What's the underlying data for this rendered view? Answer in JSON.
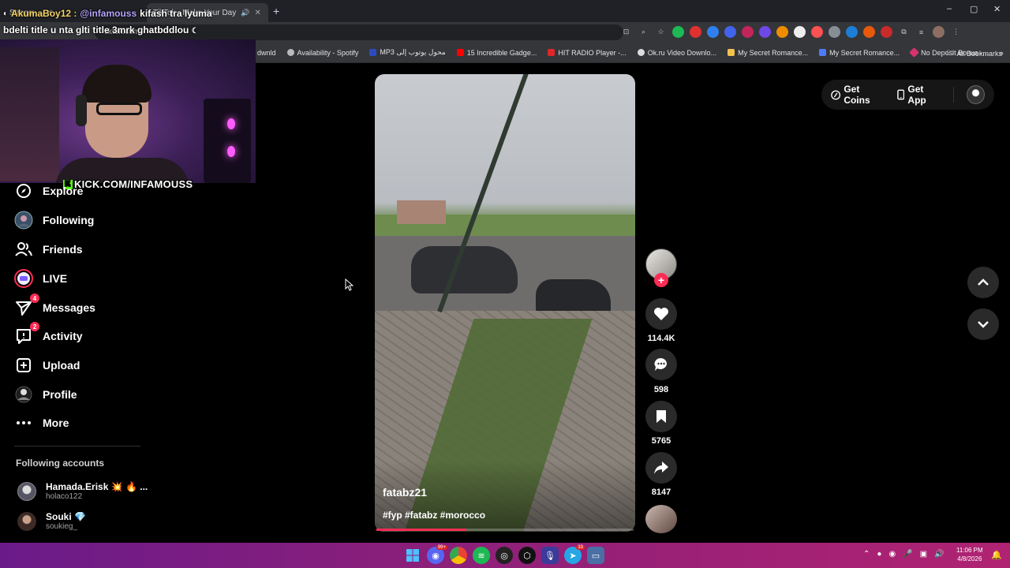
{
  "browser": {
    "tabs": [
      {
        "label": "Stream..."
      },
      {
        "label": "TikTok - Make Your Day"
      }
    ],
    "url": "tiktok.com",
    "new_tab": "+",
    "window": {
      "minimize": "–",
      "maximize": "▢",
      "close": "✕"
    },
    "bookmarks": [
      {
        "label": "dwnld",
        "color": "#888888"
      },
      {
        "label": "Availability - Spotify",
        "color": "#bbbbbb"
      },
      {
        "label": "MP3 محول يوتوب إلى",
        "color": "#2b4cbf"
      },
      {
        "label": "15 Incredible Gadge...",
        "color": "#ff0000"
      },
      {
        "label": "HIT RADIO Player -...",
        "color": "#e0262b"
      },
      {
        "label": "Ok.ru Video Downlo...",
        "color": "#dddddd"
      },
      {
        "label": "My Secret Romance...",
        "color": "#f2c14e"
      },
      {
        "label": "My Secret Romance...",
        "color": "#4d7cff"
      },
      {
        "label": "No Deposit Bonus -...",
        "color": "#d6336c"
      }
    ],
    "bookmarks_more": "»",
    "all_bookmarks": "All Bookmarks"
  },
  "overlay": {
    "chat_user": "AkumaBoy12 :",
    "chat_mention": "@infamouss",
    "chat_text_1": "kifash tra lyuma",
    "chat_text_2": "bdelti title u nta glti title 3mrk ghatbddlou",
    "kick_label": "KICK.COM/INFAMOUSS",
    "kick_logo": "K"
  },
  "sidebar": {
    "items": [
      {
        "label": "Explore"
      },
      {
        "label": "Following"
      },
      {
        "label": "Friends"
      },
      {
        "label": "LIVE"
      },
      {
        "label": "Messages",
        "badge": "4"
      },
      {
        "label": "Activity",
        "badge": "2"
      },
      {
        "label": "Upload"
      },
      {
        "label": "Profile"
      },
      {
        "label": "More"
      }
    ],
    "following_title": "Following accounts",
    "accounts": [
      {
        "name": "Hamada.Erisk 💥 🔥 ...",
        "handle": "holaco122"
      },
      {
        "name": "Souki 💎",
        "handle": "soukieg_"
      }
    ]
  },
  "header": {
    "get_coins": "Get Coins",
    "get_app": "Get App"
  },
  "video": {
    "author": "fatabz21",
    "tags": "#fyp #fatabz #morocco",
    "progress": 0.35
  },
  "actions": {
    "likes": "114.4K",
    "comments": "598",
    "saves": "5765",
    "shares": "8147"
  },
  "taskbar": {
    "time": "11:06 PM",
    "date": "4/8/2026",
    "discord_badge": "99+",
    "app_badge": "33"
  },
  "colors": {
    "accent": "#fe2c55",
    "kick_green": "#53fc18"
  }
}
